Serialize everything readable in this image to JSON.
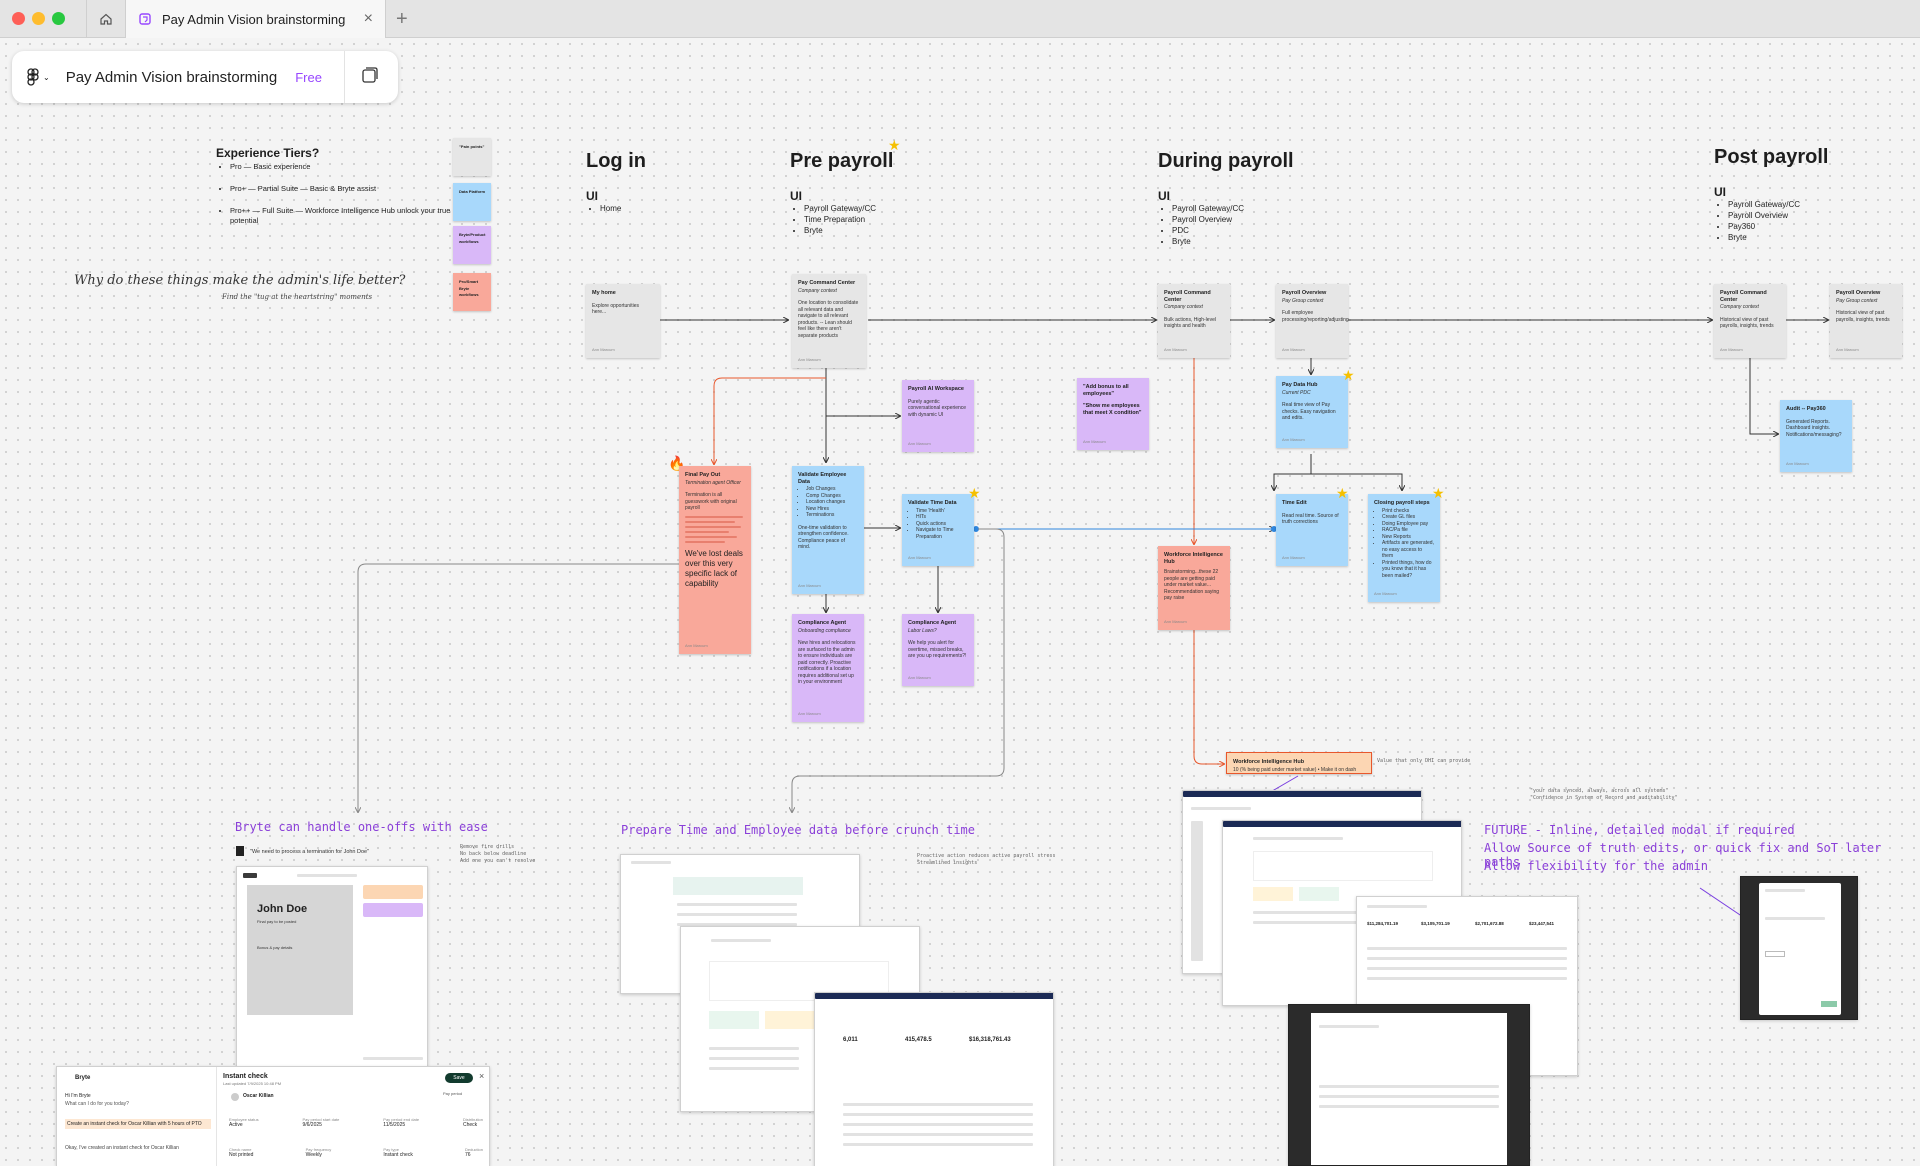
{
  "window": {
    "tab_title": "Pay Admin Vision brainstorming",
    "home_icon": "home-icon",
    "file_icon": "figjam-file-icon",
    "close_icon": "close-icon",
    "new_tab_icon": "plus-icon"
  },
  "filebar": {
    "menu_icon": "figma-logo-icon",
    "file_name": "Pay Admin Vision brainstorming",
    "plan": "Free",
    "panel_icon": "panels-icon"
  },
  "colors": {
    "titlebar": "#e4e4e4",
    "canvas": "#f4f4f4",
    "sticky_grey": "#e6e6e6",
    "sticky_purple": "#d9b8f8",
    "sticky_blue": "#a8d8fb",
    "sticky_red": "#f9a89a",
    "sticky_orange": "#fcd6b3",
    "accent_purple": "#9747ff",
    "connector_red": "#e8572c",
    "connector_blue": "#2e86de"
  },
  "tiers": {
    "title": "Experience Tiers?",
    "items": [
      "Pro — Basic experience",
      "Pro+ — Partial Suite — Basic & Bryte assist",
      "Pro++ — Full Suite — Workforce Intelligence Hub unlock your true potential"
    ]
  },
  "legend_notes": [
    {
      "text": "\"Pain points\""
    },
    {
      "text": "Data Platform"
    },
    {
      "text": "Bryte/Product workflows"
    },
    {
      "text": "Pro/Smart Bryte workflows"
    }
  ],
  "why": {
    "title": "Why do these things make the admin's life better?",
    "subtitle": "Find the \"tug at the heartstring\" moments"
  },
  "columns": [
    {
      "title": "Log in",
      "ui": "UI",
      "items": [
        "Home"
      ]
    },
    {
      "title": "Pre payroll",
      "ui": "UI",
      "items": [
        "Payroll Gateway/CC",
        "Time Preparation",
        "Bryte"
      ]
    },
    {
      "title": "During payroll",
      "ui": "UI",
      "items": [
        "Payroll Gateway/CC",
        "Payroll Overview",
        "PDC",
        "Bryte"
      ]
    },
    {
      "title": "Post payroll",
      "ui": "UI",
      "items": [
        "Payroll Gateway/CC",
        "Payroll Overview",
        "Pay360",
        "Bryte"
      ]
    }
  ],
  "stickies": {
    "my_home": {
      "title": "My home",
      "body": "Explore opportunities here...",
      "footer": "Ann Marcum"
    },
    "pcc_pre": {
      "title": "Pay Command Center",
      "sub": "Company context",
      "body": "One location to consolidate all relevant data and navigate to all relevant products. -- Lean should feel like there aren't separate products",
      "footer": "Ann Marcum"
    },
    "payroll_ai": {
      "title": "Payroll AI Workspace",
      "body": "Purely agentic conversational experience with dynamic UI",
      "footer": "Ann Marcum"
    },
    "final_pay": {
      "title": "Final Pay Out",
      "sub": "Termination agent Officer",
      "body": "Termination is all guesswork with original payroll",
      "big": "We've lost deals over this very specific lack of capability",
      "footer": "Ann Marcum"
    },
    "validate_emp": {
      "title": "Validate Employee Data",
      "items": [
        "Job Changes",
        "Comp Changes",
        "Location changes",
        "New Hires",
        "Terminations"
      ],
      "body": "One-time validation to strengthen confidence. Compliance peace of mind.",
      "footer": "Ann Marcum"
    },
    "validate_time": {
      "title": "Validate Time Data",
      "items": [
        "Time 'Health'",
        "HITs",
        "Quick actions",
        "Navigate to Time Preparation"
      ],
      "footer": "Ann Marcum"
    },
    "compliance_pre": {
      "title": "Compliance Agent",
      "sub": "Onboarding compliance",
      "body": "New hires and relocations are surfaced to the admin to ensure individuals are paid correctly. Proactive notifications if a location requires additional set up in your environment",
      "footer": "Ann Marcum"
    },
    "compliance_time": {
      "title": "Compliance Agent",
      "sub": "Labor Laws?",
      "body": "We help you alert for overtime, missed breaks, are you up requirements?!",
      "footer": "Ann Marcum"
    },
    "add_bonus": {
      "title": "\"Add bonus to all employees\"",
      "body": "\"Show me employees that meet X condition\"",
      "footer": "Ann Marcum"
    },
    "pcc_during": {
      "title": "Payroll Command Center",
      "sub": "Company context",
      "body": "Bulk actions, High-level insights and health",
      "footer": "Ann Marcum"
    },
    "pay_overview": {
      "title": "Payroll Overview",
      "sub": "Pay Group context",
      "body": "Full employee processing/reporting/adjusting",
      "footer": "Ann Marcum"
    },
    "pay_data_hub": {
      "title": "Pay Data Hub",
      "sub": "Current PDC",
      "body": "Real time view of Pay checks. Easy navigation and edits.",
      "footer": "Ann Marcum"
    },
    "time_edit": {
      "title": "Time Edit",
      "body": "Read real time. Source of truth corrections",
      "footer": "Ann Marcum"
    },
    "closing_steps": {
      "title": "Closing payroll steps",
      "items": [
        "Print checks",
        "Create GL files",
        "Doing Employee pay",
        "RAC/Pa file",
        "New Reports",
        "Artifacts are generated, no easy access to them",
        "Printed things, how do you know that it has been mailed?"
      ],
      "footer": "Ann Marcum"
    },
    "wih_during": {
      "title": "Workforce Intelligence Hub",
      "body": "Brainstorming...these 22 people are getting paid under market value... Recommendation saying pay raise",
      "footer": "Ann Marcum"
    },
    "pcc_post": {
      "title": "Payroll Command Center",
      "sub": "Company context",
      "body": "Historical view of past payrolls, insights, trends",
      "footer": "Ann Marcum"
    },
    "pay_overview_post": {
      "title": "Payroll Overview",
      "sub": "Pay Group context",
      "body": "Historical view of past payrolls, insights, trends",
      "footer": "Ann Marcum"
    },
    "audit": {
      "title": "Audit -- Pay360",
      "body": "Generated Reports. Dashboard insights. Notifications/messaging?",
      "footer": "Ann Marcum"
    },
    "wih_bottom": {
      "title": "Workforce Intelligence Hub",
      "body": "10 (% being paid under market value) • Make it on dash"
    }
  },
  "annotations": {
    "bryte_oneoffs": "Bryte can handle one-offs with ease",
    "bryte_quote": "\"We need to process a termination for John Doe\"",
    "bryte_notes": "Remove fire drills\nNo back below deadline\nAdd one you can't resolve",
    "prepare": "Prepare Time and Employee data before crunch time",
    "prepare_note": "Proactive action reduces active payroll stress\nStreamlined insights",
    "wih_note": "Value that only DHI can provide",
    "quotes_note": "\"your data synced, always, across all systems\"\n\"Confidence in System of Record and auditability\"",
    "future_1": "FUTURE - Inline, detailed modal if required",
    "future_2": "Allow Source of truth edits, or quick fix and SoT later paths",
    "future_3": "Allow flexibility for the admin"
  },
  "mock_bryte": {
    "name": "John Doe",
    "sub": "Final pay to be posted",
    "sub2": "Bonus & pay details"
  },
  "mock_instant": {
    "app": "Bryte",
    "greeting": "Hi I'm Bryte",
    "question": "What can I do for you today?",
    "request": "Create an instant check for Oscar Killian with 5 hours of PTO",
    "reply": "Okay, I've created an instant check for Oscar Killian",
    "header": "Instant check",
    "header_sub": "Last updated 7/9/2025 10:48 PM",
    "button": "Save",
    "employee": "Oscar Killian",
    "fields": [
      {
        "label": "Employee status",
        "value": "Active"
      },
      {
        "label": "Pay period start date",
        "value": "9/6/2025"
      },
      {
        "label": "Pay period end date",
        "value": "11/5/2025"
      },
      {
        "label": "Distribution",
        "value": "Check"
      }
    ],
    "fields2": [
      {
        "label": "Check name",
        "value": "Not printed"
      },
      {
        "label": "Pay frequency",
        "value": "Weekly"
      },
      {
        "label": "Pay type",
        "value": "Instant check"
      },
      {
        "label": "Deduction",
        "value": "76"
      }
    ],
    "pay_period": "Pay period"
  },
  "mock_payroll": {
    "kpis": [
      "6,011",
      "415,478.5",
      "$16,318,761.43"
    ],
    "kpis2": [
      "$11,284,701.19",
      "$3,105,701.19",
      "$2,701,672.88",
      "$23,447,541"
    ]
  }
}
